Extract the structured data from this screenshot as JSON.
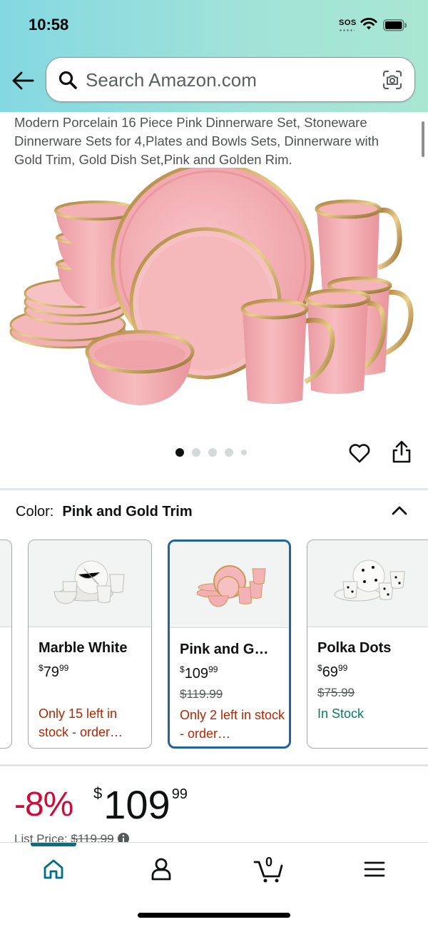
{
  "status_bar": {
    "time": "10:58",
    "sos": "SOS"
  },
  "search": {
    "placeholder": "Search Amazon.com"
  },
  "product": {
    "title": "Modern Porcelain 16 Piece Pink Dinnerware Set, Stoneware Dinnerware Sets for 4,Plates and Bowls Sets, Dinnerware with Gold Trim, Gold Dish Set,Pink and Golden Rim.",
    "image_count": 5,
    "active_image": 1
  },
  "color": {
    "label": "Color:",
    "value": "Pink and Gold Trim"
  },
  "swatches": [
    {
      "name": "Marble White",
      "currency": "$",
      "price_whole": "79",
      "price_cents": "99",
      "was": "",
      "stock": "Only 15 left in stock - order…",
      "stock_status": "low",
      "selected": false
    },
    {
      "name": "Pink and G…",
      "currency": "$",
      "price_whole": "109",
      "price_cents": "99",
      "was": "$119.99",
      "stock": "Only 2 left in stock - order…",
      "stock_status": "low",
      "selected": true
    },
    {
      "name": "Polka Dots",
      "currency": "$",
      "price_whole": "69",
      "price_cents": "99",
      "was": "$75.99",
      "stock": "In Stock",
      "stock_status": "in",
      "selected": false
    }
  ],
  "price": {
    "discount": "-8%",
    "currency": "$",
    "whole": "109",
    "cents": "99",
    "list_label": "List Price:",
    "list_value": "$119.99"
  },
  "nav": {
    "items": [
      "home-icon",
      "account-icon",
      "cart-icon",
      "menu-icon"
    ],
    "cart_count": "0",
    "active": "home"
  },
  "colors": {
    "accent": "#007185",
    "selected_border": "#2162a1",
    "discount": "#cc0c39",
    "low_stock": "#b12704",
    "in_stock": "#067d62"
  }
}
